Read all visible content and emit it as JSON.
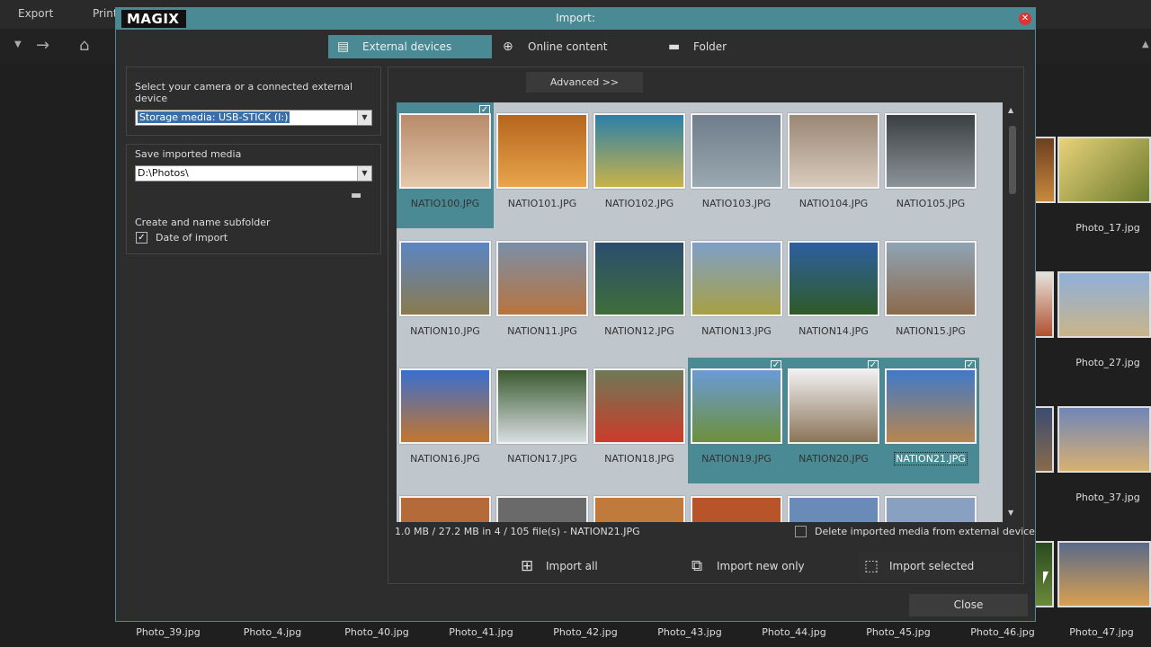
{
  "app": {
    "menu": [
      "Export",
      "Print"
    ]
  },
  "dialog": {
    "logo": "MAGIX",
    "title": "Import:",
    "tabs": [
      {
        "label": "External devices",
        "icon": "sd-card-icon"
      },
      {
        "label": "Online content",
        "icon": "globe-icon"
      },
      {
        "label": "Folder",
        "icon": "folder-icon"
      }
    ],
    "device_label": "Select your camera or a connected external device",
    "device_value": "Storage media: USB-STICK (I:)",
    "save_label": "Save imported media",
    "save_path": "D:\\Photos\\",
    "subfolder_label": "Create and name subfolder",
    "date_label": "Date of import",
    "date_checked": true,
    "advanced": "Advanced >>",
    "files": [
      {
        "name": "NATIO100.JPG",
        "selected": true,
        "colors": [
          "#b88a6a",
          "#e3c9aa"
        ]
      },
      {
        "name": "NATIO101.JPG",
        "selected": false,
        "colors": [
          "#b5651d",
          "#e8a54b"
        ]
      },
      {
        "name": "NATIO102.JPG",
        "selected": false,
        "colors": [
          "#2b7fa8",
          "#c8b24a"
        ]
      },
      {
        "name": "NATIO103.JPG",
        "selected": false,
        "colors": [
          "#6f7d8c",
          "#9aa8b0"
        ]
      },
      {
        "name": "NATIO104.JPG",
        "selected": false,
        "colors": [
          "#9a8774",
          "#d9cbbd"
        ]
      },
      {
        "name": "NATIO105.JPG",
        "selected": false,
        "colors": [
          "#3a3f42",
          "#8d9499"
        ]
      },
      {
        "name": "NATION10.JPG",
        "selected": false,
        "colors": [
          "#5b86c4",
          "#8a7a4e"
        ]
      },
      {
        "name": "NATION11.JPG",
        "selected": false,
        "colors": [
          "#7a8fa8",
          "#b8743e"
        ]
      },
      {
        "name": "NATION12.JPG",
        "selected": false,
        "colors": [
          "#2a4d6e",
          "#3f6e3a"
        ]
      },
      {
        "name": "NATION13.JPG",
        "selected": false,
        "colors": [
          "#7ea0c9",
          "#a8a044"
        ]
      },
      {
        "name": "NATION14.JPG",
        "selected": false,
        "colors": [
          "#2d5fa0",
          "#2f5a28"
        ]
      },
      {
        "name": "NATION15.JPG",
        "selected": false,
        "colors": [
          "#8fa4b5",
          "#8c6a4c"
        ]
      },
      {
        "name": "NATION16.JPG",
        "selected": false,
        "colors": [
          "#3a6ed0",
          "#c4762c"
        ]
      },
      {
        "name": "NATION17.JPG",
        "selected": false,
        "colors": [
          "#3a5a30",
          "#d8dde0"
        ]
      },
      {
        "name": "NATION18.JPG",
        "selected": false,
        "colors": [
          "#6d7a56",
          "#cc3b2a"
        ]
      },
      {
        "name": "NATION19.JPG",
        "selected": true,
        "colors": [
          "#6a9bd6",
          "#6d8f3a"
        ]
      },
      {
        "name": "NATION20.JPG",
        "selected": true,
        "colors": [
          "#f0f0f0",
          "#8c7458"
        ]
      },
      {
        "name": "NATION21.JPG",
        "selected": true,
        "focused": true,
        "colors": [
          "#3f79c8",
          "#b8864e"
        ]
      }
    ],
    "status": "1.0 MB / 27.2 MB in 4 / 105 file(s)   -   NATION21.JPG",
    "delete_label": "Delete imported media from external device",
    "buttons": {
      "import_all": "Import all",
      "import_new": "Import new only",
      "import_selected": "Import selected",
      "close": "Close"
    }
  },
  "background": {
    "right_labels": [
      "Photo_17.jpg",
      "Photo_27.jpg",
      "Photo_37.jpg"
    ],
    "bottom_labels": [
      "Photo_39.jpg",
      "Photo_4.jpg",
      "Photo_40.jpg",
      "Photo_41.jpg",
      "Photo_42.jpg",
      "Photo_43.jpg",
      "Photo_44.jpg",
      "Photo_45.jpg",
      "Photo_46.jpg",
      "Photo_47.jpg"
    ]
  }
}
